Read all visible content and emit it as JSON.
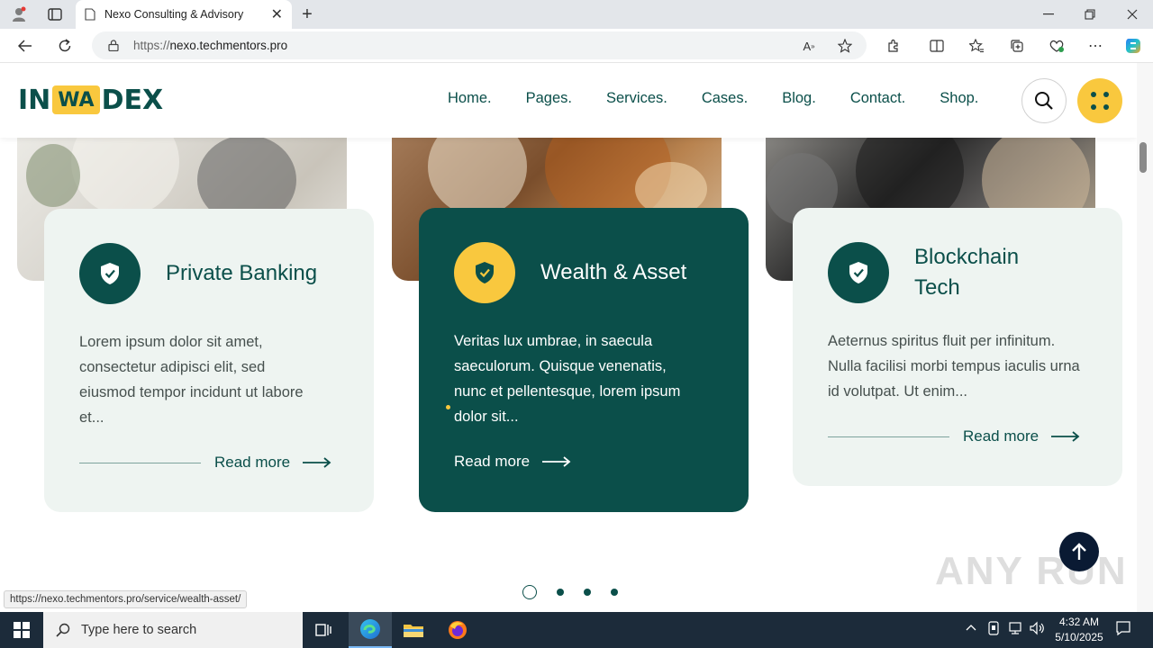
{
  "browser": {
    "tab_title": "Nexo Consulting & Advisory",
    "url_prefix": "https://",
    "url_host": "nexo.techmentors.pro",
    "status_url": "https://nexo.techmentors.pro/service/wealth-asset/"
  },
  "site": {
    "logo": {
      "left": "IN",
      "mid": "WA",
      "right": "DEX"
    },
    "nav": [
      "Home.",
      "Pages.",
      "Services.",
      "Cases.",
      "Blog.",
      "Contact.",
      "Shop."
    ],
    "cards": [
      {
        "title": "Private Banking",
        "text": "Lorem ipsum dolor sit amet, consectetur adipisci elit, sed eiusmod tempor incidunt ut labore et...",
        "link": "Read more",
        "icon": "shield-check-icon"
      },
      {
        "title": "Wealth & Asset",
        "text": "Veritas lux umbrae, in saecula saeculorum. Quisque venenatis, nunc et pellentesque, lorem ipsum dolor sit...",
        "link": "Read more",
        "icon": "shield-check-icon"
      },
      {
        "title": "Blockchain Tech",
        "text": "Aeternus spiritus fluit per infinitum. Nulla facilisi morbi tempus iaculis urna id volutpat. Ut enim...",
        "link": "Read more",
        "icon": "shield-check-icon"
      }
    ],
    "slider_dots": 4,
    "slider_active": 1,
    "watermark": "ANY RUN"
  },
  "colors": {
    "primary": "#0b4f4a",
    "accent": "#f9c83e",
    "card_light": "#eef4f1"
  },
  "taskbar": {
    "search_placeholder": "Type here to search",
    "time": "4:32 AM",
    "date": "5/10/2025"
  }
}
